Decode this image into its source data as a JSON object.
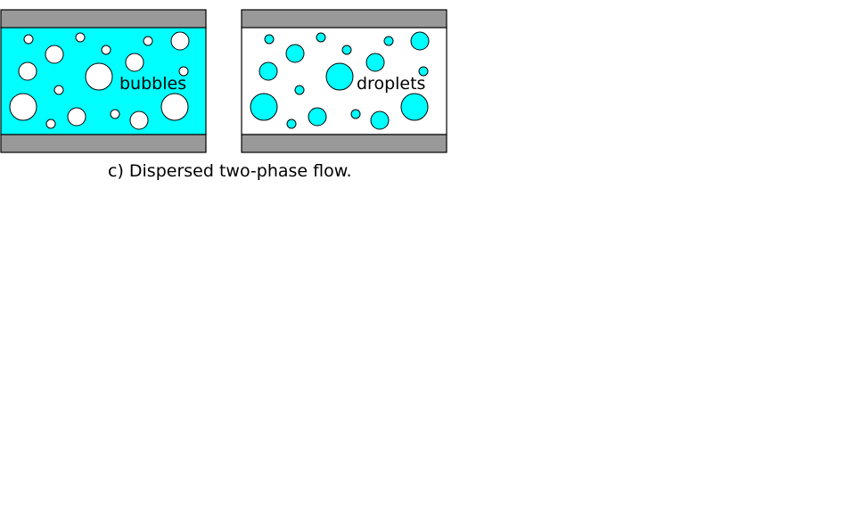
{
  "panels": [
    {
      "id": "bubbles",
      "label": "bubbles",
      "fluid_color": "#00ffff",
      "particle_color": "#ffffff"
    },
    {
      "id": "droplets",
      "label": "droplets",
      "fluid_color": "#ffffff",
      "particle_color": "#00ffff"
    }
  ],
  "wall_color": "#999999",
  "outline_color": "#000000",
  "caption": "c) Dispersed two-phase flow."
}
